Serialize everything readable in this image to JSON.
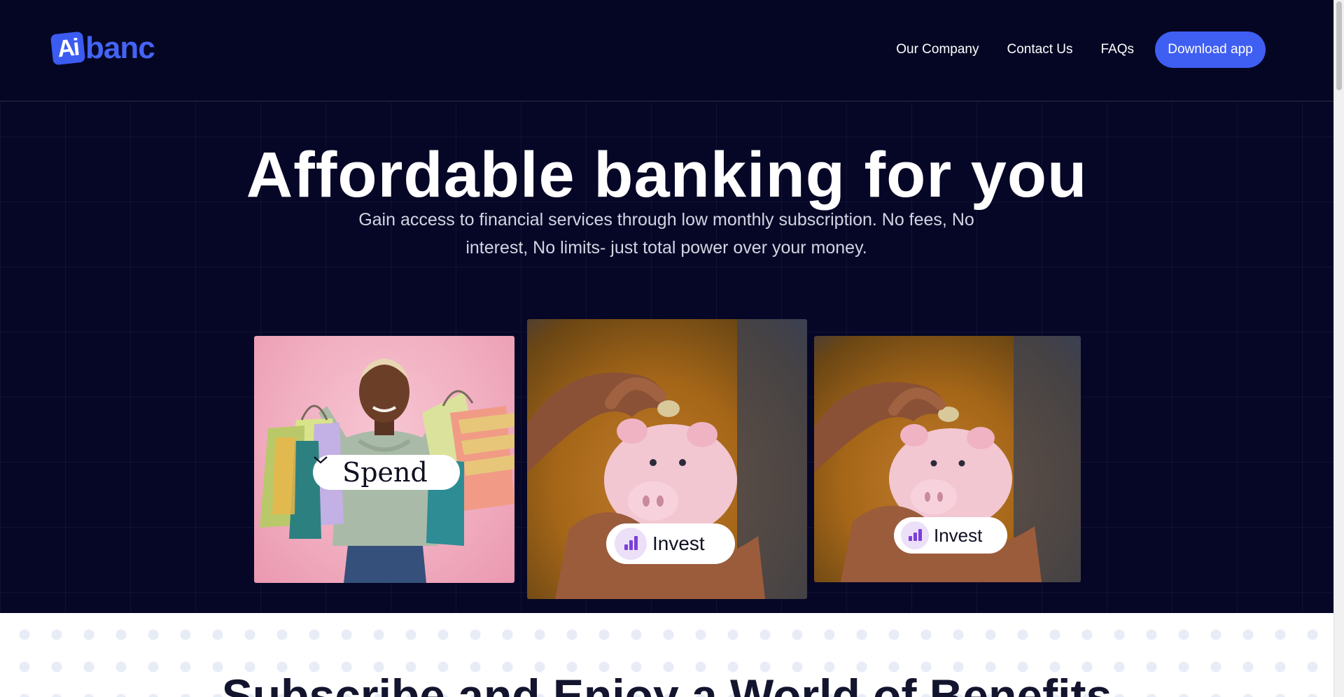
{
  "header": {
    "logo": {
      "mark": "Ai",
      "rest": "banc"
    },
    "nav": [
      {
        "label": "Our Company"
      },
      {
        "label": "Contact Us"
      },
      {
        "label": "FAQs"
      }
    ],
    "download_label": "Download app"
  },
  "hero": {
    "title": "Affordable banking for you",
    "subtitle": "Gain access to financial services through low monthly subscription. No fees, No interest, No limits- just total power over your money.",
    "cards": [
      {
        "pill": "Spend",
        "image": "woman-with-shopping-bags"
      },
      {
        "pill": "Invest",
        "image": "hand-with-piggy-bank"
      },
      {
        "pill": "Invest",
        "image": "hand-with-piggy-bank"
      }
    ]
  },
  "benefits": {
    "title": "Subscribe and Enjoy a World of Benefits"
  },
  "colors": {
    "background": "#050624",
    "accent": "#3f5ef2",
    "text_light": "#ffffff",
    "subtitle": "#d3d4e2",
    "invest_icon": "#7b3fd8"
  },
  "icons": {
    "spend_dropdown": "chevron-down-icon",
    "invest": "bar-chart-icon"
  }
}
